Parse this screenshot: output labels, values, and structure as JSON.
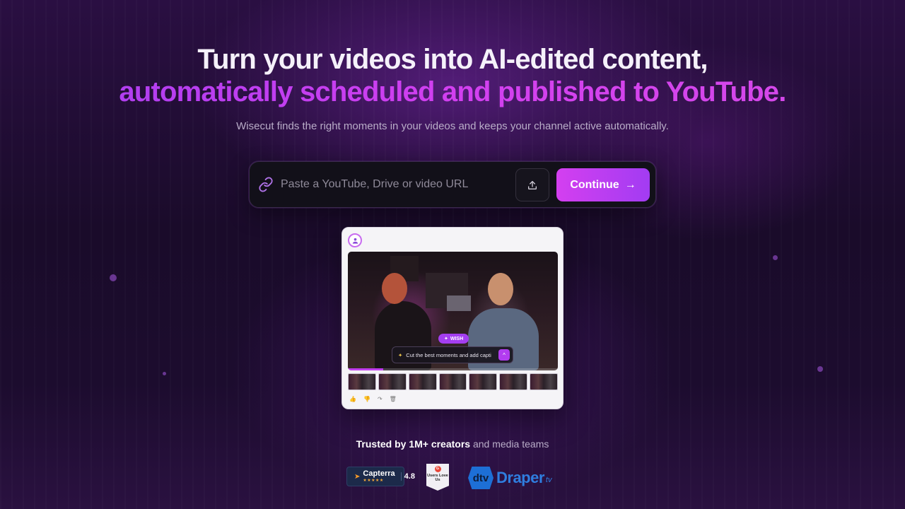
{
  "hero": {
    "title_line1": "Turn your videos into AI-edited content,",
    "title_line2": "automatically scheduled and published to YouTube.",
    "subtitle": "Wisecut finds the right moments in your videos and keeps your channel active automatically."
  },
  "url_form": {
    "placeholder": "Paste a YouTube, Drive or video URL",
    "value": "",
    "continue_label": "Continue",
    "continue_arrow": "→"
  },
  "preview": {
    "wish_badge": "WISH",
    "prompt_text": "Cut the best moments and add capti",
    "prompt_send": "^",
    "progress": 0.17,
    "thumbnail_count": 7,
    "actions": [
      "👍",
      "👎",
      "↷",
      "🗑"
    ]
  },
  "trusted": {
    "bold": "Trusted by 1M+ creators",
    "rest": " and media teams"
  },
  "logos": {
    "capterra": {
      "name": "Capterra",
      "stars": "★★★★★",
      "rating": "4.8"
    },
    "g2": {
      "mark": "G",
      "text": "Users Love Us"
    },
    "draper": {
      "mark": "dtv",
      "name": "Draper",
      "suffix": "tv"
    }
  },
  "colors": {
    "accent": "#c23ef0",
    "button_gradient_start": "#d43ff0",
    "button_gradient_end": "#a23cf2",
    "background": "#1a0b2a"
  },
  "icons": {
    "url_field": "link-icon",
    "upload": "upload-icon",
    "continue": "arrow-right-icon",
    "avatar": "user-icon"
  }
}
